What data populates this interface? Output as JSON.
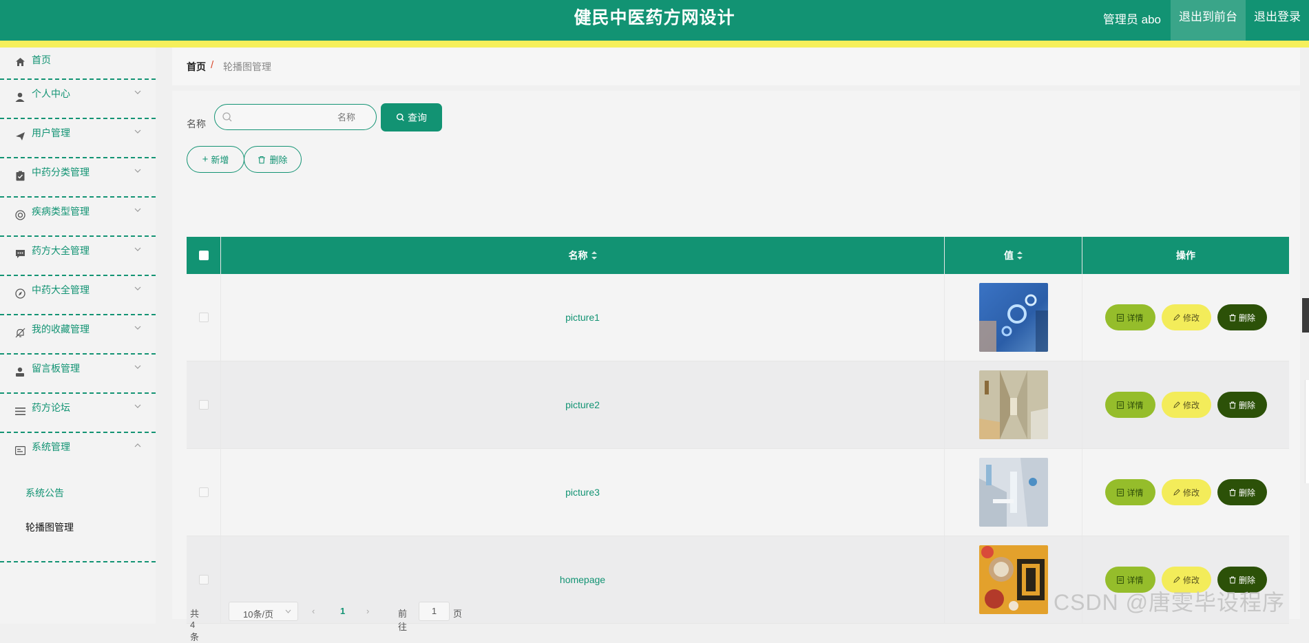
{
  "header": {
    "title": "健民中医药方网设计",
    "user": "管理员 abo",
    "btn_frontend": "退出到前台",
    "btn_logout": "退出登录"
  },
  "sidebar": {
    "items": [
      {
        "label": "首页",
        "icon": "home-icon"
      },
      {
        "label": "个人中心",
        "icon": "user-icon"
      },
      {
        "label": "用户管理",
        "icon": "send-icon"
      },
      {
        "label": "中药分类管理",
        "icon": "clipboard-icon"
      },
      {
        "label": "疾病类型管理",
        "icon": "lifebuoy-icon"
      },
      {
        "label": "药方大全管理",
        "icon": "chat-icon"
      },
      {
        "label": "中药大全管理",
        "icon": "compass-icon"
      },
      {
        "label": "我的收藏管理",
        "icon": "bell-off-icon"
      },
      {
        "label": "留言板管理",
        "icon": "person-icon"
      },
      {
        "label": "药方论坛",
        "icon": "list-icon"
      },
      {
        "label": "系统管理",
        "icon": "system-icon"
      }
    ],
    "sub_items": [
      "系统公告",
      "轮播图管理"
    ]
  },
  "breadcrumb": {
    "home": "首页",
    "sep": "/",
    "current": "轮播图管理"
  },
  "search": {
    "label": "名称",
    "placeholder": "名称",
    "button": "查询"
  },
  "actions": {
    "add": "新增",
    "delete": "删除"
  },
  "table": {
    "columns": [
      "名称",
      "值",
      "操作"
    ],
    "rows": [
      {
        "name": "picture1"
      },
      {
        "name": "picture2"
      },
      {
        "name": "picture3"
      },
      {
        "name": "homepage"
      }
    ],
    "op_labels": {
      "detail": "详情",
      "edit": "修改",
      "delete": "删除"
    }
  },
  "pagination": {
    "total": "共 4 条",
    "page_size": "10条/页",
    "current_page": "1",
    "goto_label": "前往",
    "goto_value": "1",
    "page_unit": "页"
  },
  "watermark": "CSDN @唐雯毕设程序",
  "colors": {
    "primary": "#129373",
    "stripe": "#f5ef5b",
    "detail": "#95bd2b",
    "edit": "#f3ec5a",
    "danger": "#2c5108"
  }
}
